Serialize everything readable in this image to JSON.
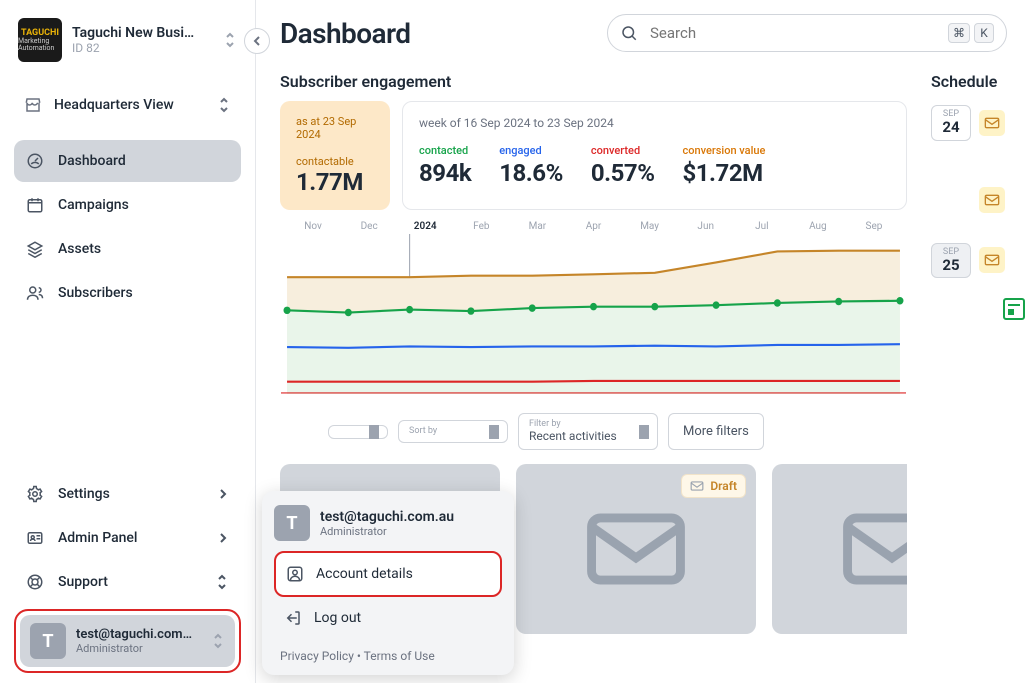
{
  "org": {
    "name": "Taguchi New Busi…",
    "sub": "ID 82"
  },
  "view": {
    "label": "Headquarters View"
  },
  "nav": {
    "dashboard": "Dashboard",
    "campaigns": "Campaigns",
    "assets": "Assets",
    "subscribers": "Subscribers",
    "settings": "Settings",
    "admin": "Admin Panel",
    "support": "Support"
  },
  "user": {
    "email_trunc": "test@taguchi.com…",
    "role": "Administrator"
  },
  "page": {
    "title": "Dashboard"
  },
  "search": {
    "placeholder": "Search",
    "kbd1": "⌘",
    "kbd2": "K"
  },
  "engagement": {
    "heading": "Subscriber engagement",
    "asat_label": "as at 23 Sep 2024",
    "contactable_label": "contactable",
    "contactable_value": "1.77M",
    "week_label": "week of 16 Sep 2024 to 23 Sep 2024",
    "contacted_label": "contacted",
    "contacted_value": "894k",
    "engaged_label": "engaged",
    "engaged_value": "18.6%",
    "converted_label": "converted",
    "converted_value": "0.57%",
    "convval_label": "conversion value",
    "convval_value": "$1.72M"
  },
  "chart_data": {
    "type": "line",
    "months": [
      "Nov",
      "Dec",
      "2024",
      "Feb",
      "Mar",
      "Apr",
      "May",
      "Jun",
      "Jul",
      "Aug",
      "Sep"
    ],
    "current_index": 2,
    "series": [
      {
        "name": "contactable",
        "color": "#c58529",
        "values": [
          150,
          150,
          150,
          152,
          152,
          154,
          156,
          170,
          185,
          186,
          186
        ]
      },
      {
        "name": "engaged",
        "color": "#16a34a",
        "values": [
          105,
          102,
          106,
          104,
          108,
          110,
          110,
          112,
          115,
          117,
          118
        ]
      },
      {
        "name": "contacted",
        "color": "#2563eb",
        "values": [
          55,
          54,
          56,
          55,
          56,
          56,
          57,
          56,
          58,
          58,
          59
        ]
      },
      {
        "name": "converted",
        "color": "#dc2626",
        "values": [
          8,
          8,
          8,
          8,
          8,
          9,
          9,
          9,
          9,
          9,
          9
        ]
      }
    ]
  },
  "filters": {
    "sortby_t": "Sort by",
    "sortby_v": "",
    "filterby_t": "Filter by",
    "filterby_v": "Recent activities",
    "more": "More filters"
  },
  "assets_row": {
    "badge": "Draft"
  },
  "schedule": {
    "heading": "Schedule",
    "items": [
      {
        "month": "SEP",
        "day": "24"
      },
      {
        "month": "",
        "day": ""
      },
      {
        "month": "SEP",
        "day": "25"
      }
    ]
  },
  "popover": {
    "email": "test@taguchi.com.au",
    "role": "Administrator",
    "account": "Account details",
    "logout": "Log out",
    "footer": "Privacy Policy  •  Terms of Use"
  }
}
